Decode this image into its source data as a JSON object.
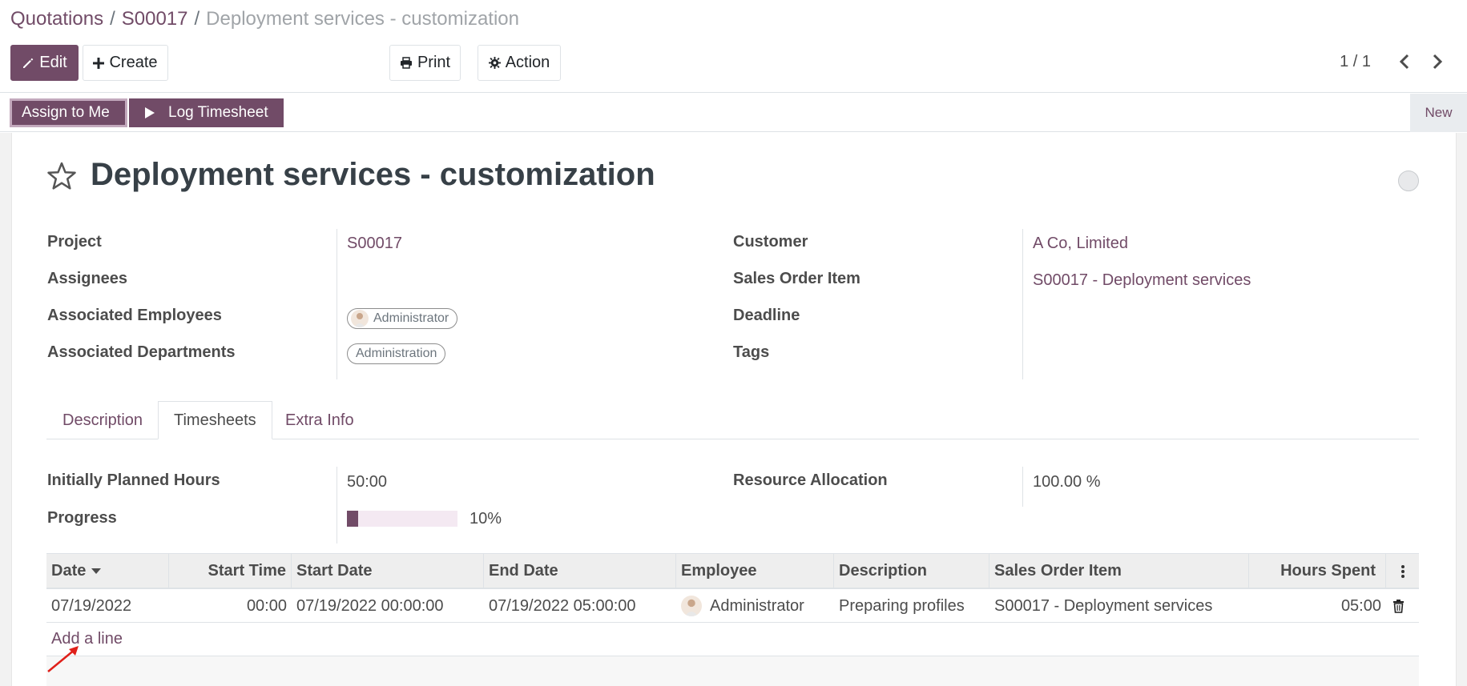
{
  "breadcrumb": {
    "root": "Quotations",
    "parent": "S00017",
    "current": "Deployment services - customization",
    "separator": "/"
  },
  "toolbar": {
    "edit_label": "Edit",
    "create_label": "Create",
    "print_label": "Print",
    "action_label": "Action"
  },
  "pager": {
    "value": "1 / 1"
  },
  "statusbar": {
    "assign_label": "Assign to Me",
    "log_label": "Log Timesheet",
    "stage": "New"
  },
  "task": {
    "title": "Deployment services - customization"
  },
  "fields": {
    "project_label": "Project",
    "project_value": "S00017",
    "assignees_label": "Assignees",
    "employees_label": "Associated Employees",
    "employee_tag": "Administrator",
    "departments_label": "Associated Departments",
    "department_tag": "Administration",
    "customer_label": "Customer",
    "customer_value": "A Co, Limited",
    "so_item_label": "Sales Order Item",
    "so_item_value": "S00017 - Deployment services",
    "deadline_label": "Deadline",
    "tags_label": "Tags"
  },
  "tabs": [
    {
      "label": "Description"
    },
    {
      "label": "Timesheets"
    },
    {
      "label": "Extra Info"
    }
  ],
  "timesheets": {
    "planned_label": "Initially Planned Hours",
    "planned_value": "50:00",
    "allocation_label": "Resource Allocation",
    "allocation_value": "100.00",
    "allocation_unit": "%",
    "progress_label": "Progress",
    "progress_value": "10%",
    "progress_fraction": 0.1,
    "columns": [
      "Date",
      "Start Time",
      "Start Date",
      "End Date",
      "Employee",
      "Description",
      "Sales Order Item",
      "Hours Spent"
    ],
    "rows": [
      {
        "date": "07/19/2022",
        "start_time": "00:00",
        "start_date": "07/19/2022 00:00:00",
        "end_date": "07/19/2022 05:00:00",
        "employee": "Administrator",
        "description": "Preparing profiles",
        "so_item": "S00017 - Deployment services",
        "hours": "05:00"
      }
    ],
    "add_line": "Add a line"
  },
  "colors": {
    "brand": "#714B67",
    "annotation_arrow": "#e0201a"
  }
}
